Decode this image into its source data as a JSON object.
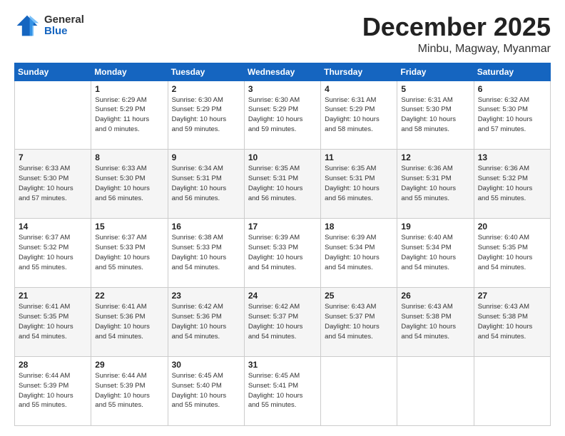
{
  "logo": {
    "general": "General",
    "blue": "Blue"
  },
  "header": {
    "month": "December 2025",
    "location": "Minbu, Magway, Myanmar"
  },
  "weekdays": [
    "Sunday",
    "Monday",
    "Tuesday",
    "Wednesday",
    "Thursday",
    "Friday",
    "Saturday"
  ],
  "weeks": [
    [
      {
        "day": "",
        "info": ""
      },
      {
        "day": "1",
        "info": "Sunrise: 6:29 AM\nSunset: 5:29 PM\nDaylight: 11 hours\nand 0 minutes."
      },
      {
        "day": "2",
        "info": "Sunrise: 6:30 AM\nSunset: 5:29 PM\nDaylight: 10 hours\nand 59 minutes."
      },
      {
        "day": "3",
        "info": "Sunrise: 6:30 AM\nSunset: 5:29 PM\nDaylight: 10 hours\nand 59 minutes."
      },
      {
        "day": "4",
        "info": "Sunrise: 6:31 AM\nSunset: 5:29 PM\nDaylight: 10 hours\nand 58 minutes."
      },
      {
        "day": "5",
        "info": "Sunrise: 6:31 AM\nSunset: 5:30 PM\nDaylight: 10 hours\nand 58 minutes."
      },
      {
        "day": "6",
        "info": "Sunrise: 6:32 AM\nSunset: 5:30 PM\nDaylight: 10 hours\nand 57 minutes."
      }
    ],
    [
      {
        "day": "7",
        "info": "Sunrise: 6:33 AM\nSunset: 5:30 PM\nDaylight: 10 hours\nand 57 minutes."
      },
      {
        "day": "8",
        "info": "Sunrise: 6:33 AM\nSunset: 5:30 PM\nDaylight: 10 hours\nand 56 minutes."
      },
      {
        "day": "9",
        "info": "Sunrise: 6:34 AM\nSunset: 5:31 PM\nDaylight: 10 hours\nand 56 minutes."
      },
      {
        "day": "10",
        "info": "Sunrise: 6:35 AM\nSunset: 5:31 PM\nDaylight: 10 hours\nand 56 minutes."
      },
      {
        "day": "11",
        "info": "Sunrise: 6:35 AM\nSunset: 5:31 PM\nDaylight: 10 hours\nand 56 minutes."
      },
      {
        "day": "12",
        "info": "Sunrise: 6:36 AM\nSunset: 5:31 PM\nDaylight: 10 hours\nand 55 minutes."
      },
      {
        "day": "13",
        "info": "Sunrise: 6:36 AM\nSunset: 5:32 PM\nDaylight: 10 hours\nand 55 minutes."
      }
    ],
    [
      {
        "day": "14",
        "info": "Sunrise: 6:37 AM\nSunset: 5:32 PM\nDaylight: 10 hours\nand 55 minutes."
      },
      {
        "day": "15",
        "info": "Sunrise: 6:37 AM\nSunset: 5:33 PM\nDaylight: 10 hours\nand 55 minutes."
      },
      {
        "day": "16",
        "info": "Sunrise: 6:38 AM\nSunset: 5:33 PM\nDaylight: 10 hours\nand 54 minutes."
      },
      {
        "day": "17",
        "info": "Sunrise: 6:39 AM\nSunset: 5:33 PM\nDaylight: 10 hours\nand 54 minutes."
      },
      {
        "day": "18",
        "info": "Sunrise: 6:39 AM\nSunset: 5:34 PM\nDaylight: 10 hours\nand 54 minutes."
      },
      {
        "day": "19",
        "info": "Sunrise: 6:40 AM\nSunset: 5:34 PM\nDaylight: 10 hours\nand 54 minutes."
      },
      {
        "day": "20",
        "info": "Sunrise: 6:40 AM\nSunset: 5:35 PM\nDaylight: 10 hours\nand 54 minutes."
      }
    ],
    [
      {
        "day": "21",
        "info": "Sunrise: 6:41 AM\nSunset: 5:35 PM\nDaylight: 10 hours\nand 54 minutes."
      },
      {
        "day": "22",
        "info": "Sunrise: 6:41 AM\nSunset: 5:36 PM\nDaylight: 10 hours\nand 54 minutes."
      },
      {
        "day": "23",
        "info": "Sunrise: 6:42 AM\nSunset: 5:36 PM\nDaylight: 10 hours\nand 54 minutes."
      },
      {
        "day": "24",
        "info": "Sunrise: 6:42 AM\nSunset: 5:37 PM\nDaylight: 10 hours\nand 54 minutes."
      },
      {
        "day": "25",
        "info": "Sunrise: 6:43 AM\nSunset: 5:37 PM\nDaylight: 10 hours\nand 54 minutes."
      },
      {
        "day": "26",
        "info": "Sunrise: 6:43 AM\nSunset: 5:38 PM\nDaylight: 10 hours\nand 54 minutes."
      },
      {
        "day": "27",
        "info": "Sunrise: 6:43 AM\nSunset: 5:38 PM\nDaylight: 10 hours\nand 54 minutes."
      }
    ],
    [
      {
        "day": "28",
        "info": "Sunrise: 6:44 AM\nSunset: 5:39 PM\nDaylight: 10 hours\nand 55 minutes."
      },
      {
        "day": "29",
        "info": "Sunrise: 6:44 AM\nSunset: 5:39 PM\nDaylight: 10 hours\nand 55 minutes."
      },
      {
        "day": "30",
        "info": "Sunrise: 6:45 AM\nSunset: 5:40 PM\nDaylight: 10 hours\nand 55 minutes."
      },
      {
        "day": "31",
        "info": "Sunrise: 6:45 AM\nSunset: 5:41 PM\nDaylight: 10 hours\nand 55 minutes."
      },
      {
        "day": "",
        "info": ""
      },
      {
        "day": "",
        "info": ""
      },
      {
        "day": "",
        "info": ""
      }
    ]
  ]
}
